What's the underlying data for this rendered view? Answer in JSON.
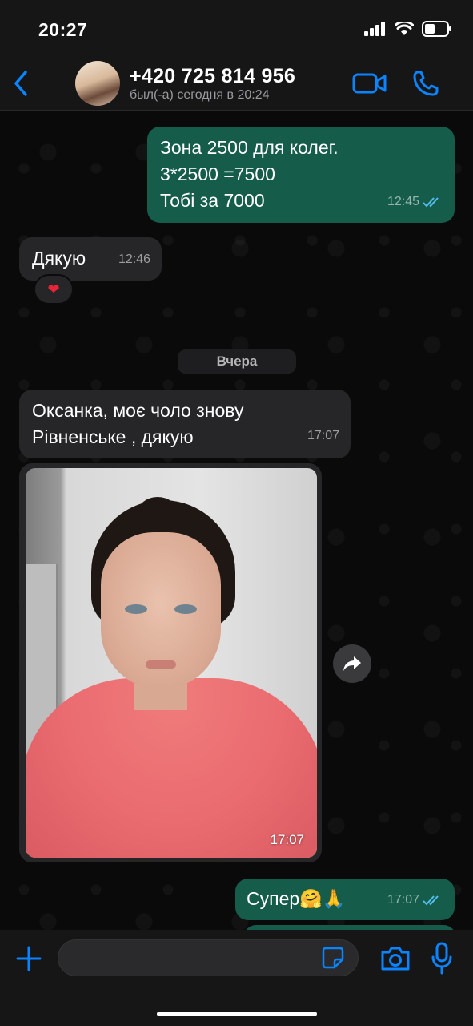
{
  "status_bar": {
    "time": "20:27"
  },
  "header": {
    "contact_name": "+420 725 814 956",
    "contact_status": "был(-а) сегодня в 20:24",
    "icons": [
      "chevron-left-icon",
      "video-call-icon",
      "phone-icon"
    ]
  },
  "messages": [
    {
      "direction": "out",
      "lines": [
        "Зона 2500 для колег.",
        "3*2500 =7500",
        "Тобі за 7000"
      ],
      "time": "12:45",
      "read": true
    },
    {
      "direction": "in",
      "lines": [
        "Дякую"
      ],
      "time": "12:46",
      "reaction": "❤"
    },
    {
      "type": "date",
      "label": "Вчера"
    },
    {
      "direction": "in",
      "lines": [
        "Оксанка, моє чоло знову",
        "Рівненське , дякую"
      ],
      "time": "17:07"
    },
    {
      "direction": "in",
      "type": "photo",
      "time": "17:07"
    },
    {
      "direction": "out",
      "lines": [
        "Супер🤗🙏"
      ],
      "time": "17:07",
      "read": true
    }
  ],
  "colors": {
    "accent": "#0a84ff",
    "outgoing": "#155c4b",
    "incoming": "#262628",
    "read_ticks": "#53bdeb"
  }
}
